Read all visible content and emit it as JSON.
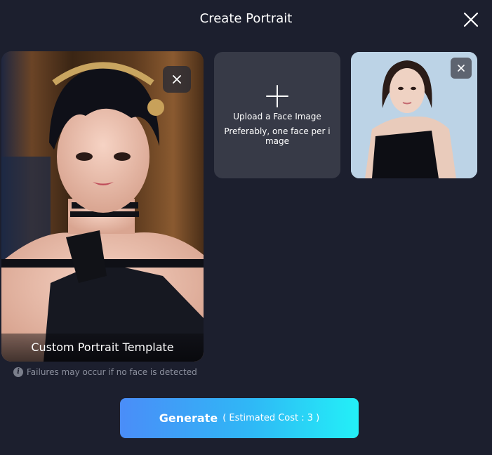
{
  "dialog": {
    "title": "Create Portrait",
    "close_icon": "close-icon"
  },
  "template": {
    "label": "Custom Portrait Template",
    "remove_icon": "close-icon"
  },
  "upload": {
    "icon": "plus-icon",
    "title": "Upload a Face Image",
    "hint": "Preferably, one face per image"
  },
  "face": {
    "remove_icon": "close-icon"
  },
  "notice": {
    "icon": "info-icon",
    "text": "Failures may occur if no face is detected"
  },
  "generate": {
    "label": "Generate",
    "cost": "( Estimated Cost : 3 )"
  },
  "colors": {
    "background": "#1c1f2e",
    "card": "#373a47",
    "button_gradient_start": "#4a8df8",
    "button_gradient_end": "#23f0f7",
    "muted_text": "#8b8f9d"
  }
}
